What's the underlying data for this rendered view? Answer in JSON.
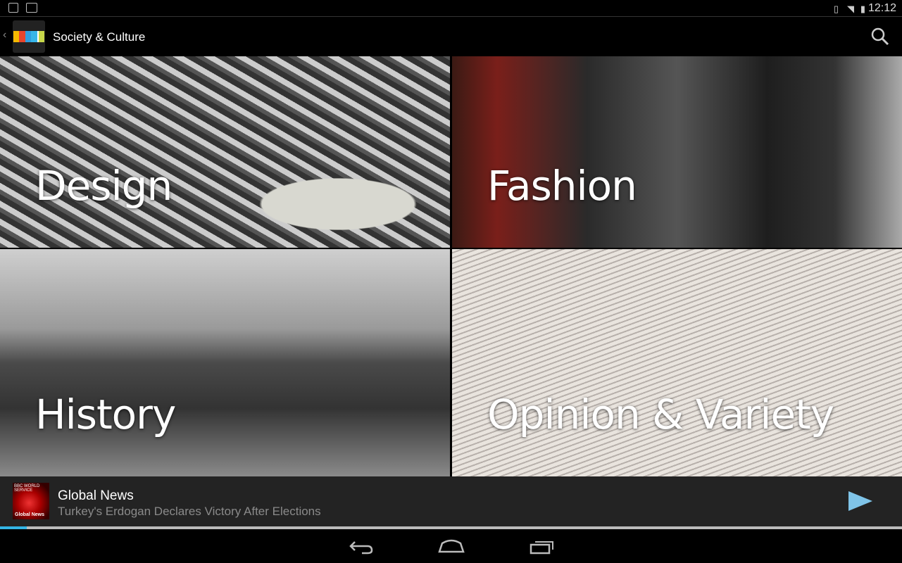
{
  "status_bar": {
    "time": "12:12",
    "left_icons": [
      "image-notification-icon",
      "bbc-notification-icon"
    ],
    "right_icons": [
      "rotation-icon",
      "wifi-icon",
      "battery-icon"
    ]
  },
  "action_bar": {
    "title": "Society & Culture",
    "logo_colors": [
      "#f5b800",
      "#e8452c",
      "#2f9fe0",
      "#37b6e8",
      "#c8d84a"
    ]
  },
  "tiles": [
    {
      "label": "Design"
    },
    {
      "label": "Fashion"
    },
    {
      "label": "History"
    },
    {
      "label": "Opinion & Variety"
    }
  ],
  "player": {
    "art_text": "Global News",
    "art_brand": "BBC WORLD SERVICE",
    "title": "Global News",
    "subtitle": "Turkey's Erdogan Declares Victory After Elections",
    "progress_percent": 3,
    "accent": "#33b5e5"
  },
  "nav_bar": {
    "buttons": [
      "back-icon",
      "home-icon",
      "recents-icon"
    ]
  }
}
